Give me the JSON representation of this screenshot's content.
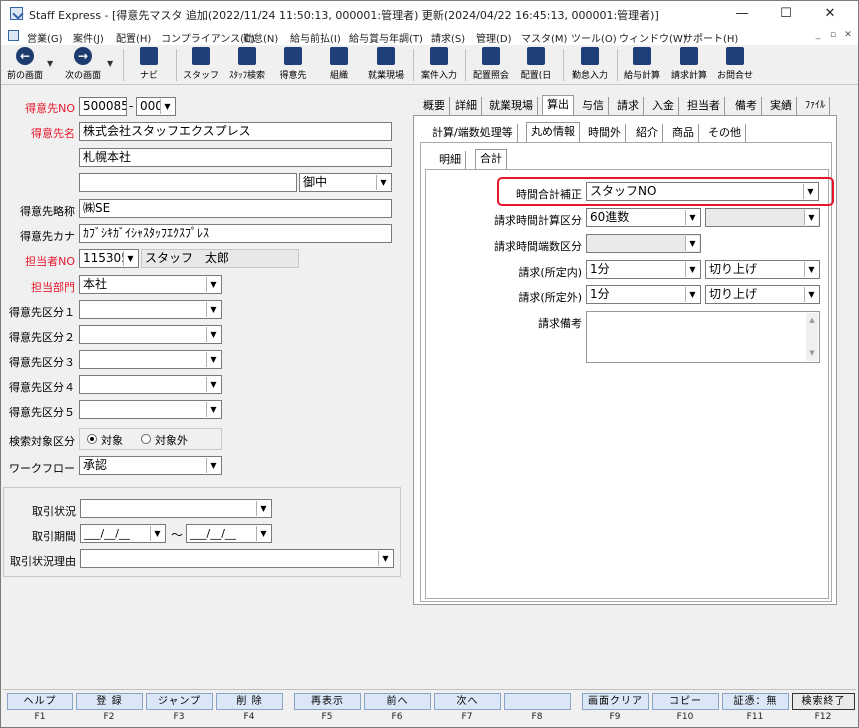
{
  "window": {
    "title": "Staff Express - [得意先マスタ 追加(2022/11/24 11:50:13, 000001:管理者) 更新(2024/04/22 16:45:13, 000001:管理者)]",
    "minimize": "—",
    "maximize": "☐",
    "close": "✕"
  },
  "menu": {
    "items": [
      "営業(G)",
      "案件(J)",
      "配置(H)",
      "コンプライアンス(C)",
      "勤怠(N)",
      "給与前払(I)",
      "給与賞与年調(T)",
      "請求(S)",
      "管理(D)",
      "マスタ(M)",
      "ツール(O)",
      "ウィンドウ(W)",
      "サポート(H)"
    ],
    "mdi_min": "_",
    "mdi_restore": "▫",
    "mdi_close": "✕"
  },
  "toolbar": {
    "prev": "前の画面",
    "next": "次の画面",
    "navi": "ナビ",
    "staff": "スタッフ",
    "staff_search": "ｽﾀｯﾌ検索",
    "customer": "得意先",
    "org": "組織",
    "worksite": "就業現場",
    "job_input": "案件入力",
    "assign_inquiry": "配置照会",
    "assign_day": "配置(日",
    "attendance_input": "勤怠入力",
    "salary_calc": "給与計算",
    "billing_calc": "請求計算",
    "inquiry": "お問合せ"
  },
  "form": {
    "customer_no_label": "得意先NO",
    "customer_no": "500085",
    "customer_no_sub": "000",
    "customer_name_label": "得意先名",
    "customer_name": "株式会社スタッフエクスプレス",
    "branch_name": "札幌本社",
    "name3": "",
    "honorific": "御中",
    "short_name_label": "得意先略称",
    "short_name": "㈱SE",
    "kana_label": "得意先カナ",
    "kana": "ｶﾌﾞｼｷｶﾞｲｼｬｽﾀｯﾌｴｸｽﾌﾟﾚｽ",
    "person_no_label": "担当者NO",
    "person_no": "115305",
    "person_name": "スタッフ　太郎",
    "dept_label": "担当部門",
    "dept": "本社",
    "cat1_label": "得意先区分１",
    "cat2_label": "得意先区分２",
    "cat3_label": "得意先区分３",
    "cat4_label": "得意先区分４",
    "cat5_label": "得意先区分５",
    "search_target_label": "検索対象区分",
    "search_target_on": "対象",
    "search_target_off": "対象外",
    "workflow_label": "ワークフロー",
    "workflow": "承認",
    "trade_status_label": "取引状況",
    "trade_period_label": "取引期間",
    "date_placeholder": "___/__/__",
    "tilde": "～",
    "trade_reason_label": "取引状況理由",
    "dash": "-"
  },
  "tabs": {
    "main": [
      "概要",
      "詳細",
      "就業現場",
      "算出",
      "与信",
      "請求",
      "入金",
      "担当者",
      "備考",
      "実績",
      "ﾌｧｲﾙ"
    ],
    "sub": [
      "計算/端数処理等",
      "丸め情報",
      "時間外",
      "紹介",
      "商品",
      "その他"
    ],
    "inner": [
      "明細",
      "合計"
    ]
  },
  "rounding": {
    "time_total_label": "時間合計補正",
    "time_total": "スタッフNO",
    "billing_calc_label": "請求時間計算区分",
    "billing_calc": "60進数",
    "billing_calc2": "",
    "billing_frac_label": "請求時間端数区分",
    "billing_frac": "",
    "billing_in_label": "請求(所定内)",
    "billing_in": "1分",
    "billing_in_mode": "切り上げ",
    "billing_out_label": "請求(所定外)",
    "billing_out": "1分",
    "billing_out_mode": "切り上げ",
    "billing_note_label": "請求備考"
  },
  "fkeys": [
    {
      "label": "ヘルプ",
      "num": "F1"
    },
    {
      "label": "登 録",
      "num": "F2"
    },
    {
      "label": "ジャンプ",
      "num": "F3"
    },
    {
      "label": "削 除",
      "num": "F4"
    },
    {
      "label": "再表示",
      "num": "F5"
    },
    {
      "label": "前へ",
      "num": "F6"
    },
    {
      "label": "次へ",
      "num": "F7"
    },
    {
      "label": "",
      "num": "F8"
    },
    {
      "label": "画面クリア",
      "num": "F9"
    },
    {
      "label": "コピー",
      "num": "F10"
    },
    {
      "label": "証憑：無",
      "num": "F11"
    },
    {
      "label": "検索終了",
      "num": "F12"
    }
  ],
  "colors": {
    "required_label": "#e8162a",
    "highlight": "#e8162a",
    "fkey_bg": "#dbe7f7"
  }
}
